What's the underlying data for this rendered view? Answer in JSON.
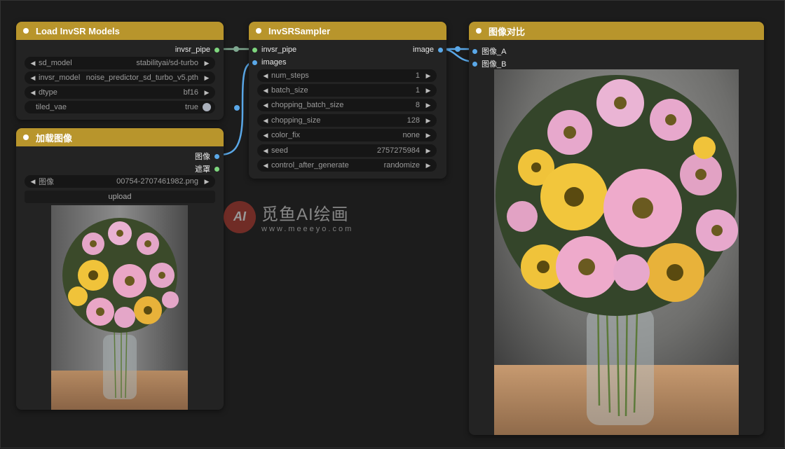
{
  "nodes": {
    "load_models": {
      "title": "Load InvSR Models",
      "output_label": "invsr_pipe",
      "widgets": [
        {
          "label": "sd_model",
          "value": "stabilityai/sd-turbo"
        },
        {
          "label": "invsr_model",
          "value": "noise_predictor_sd_turbo_v5.pth"
        },
        {
          "label": "dtype",
          "value": "bf16"
        },
        {
          "label": "tiled_vae",
          "value": "true"
        }
      ]
    },
    "load_image": {
      "title": "加载图像",
      "outputs": [
        "图像",
        "遮罩"
      ],
      "image_widget": {
        "label": "图像",
        "value": "00754-2707461982.png"
      },
      "upload_label": "upload"
    },
    "sampler": {
      "title": "InvSRSampler",
      "inputs": [
        "invsr_pipe",
        "images"
      ],
      "output_label": "image",
      "widgets": [
        {
          "label": "num_steps",
          "value": "1"
        },
        {
          "label": "batch_size",
          "value": "1"
        },
        {
          "label": "chopping_batch_size",
          "value": "8"
        },
        {
          "label": "chopping_size",
          "value": "128"
        },
        {
          "label": "color_fix",
          "value": "none"
        },
        {
          "label": "seed",
          "value": "2757275984"
        },
        {
          "label": "control_after_generate",
          "value": "randomize"
        }
      ]
    },
    "compare": {
      "title": "图像对比",
      "inputs": [
        "图像_A",
        "图像_B"
      ]
    }
  },
  "watermark": {
    "main": "觅鱼AI绘画",
    "sub": "www.meeeyo.com",
    "logo": "AI"
  },
  "colors": {
    "header": "#b8952c",
    "wire_pipe": "#7fa890",
    "wire_image": "#5aa8e8",
    "dot_green": "#7ed67e",
    "dot_blue": "#5aa8e8"
  },
  "icons": {
    "arrow_left": "◀",
    "arrow_right": "▶"
  }
}
